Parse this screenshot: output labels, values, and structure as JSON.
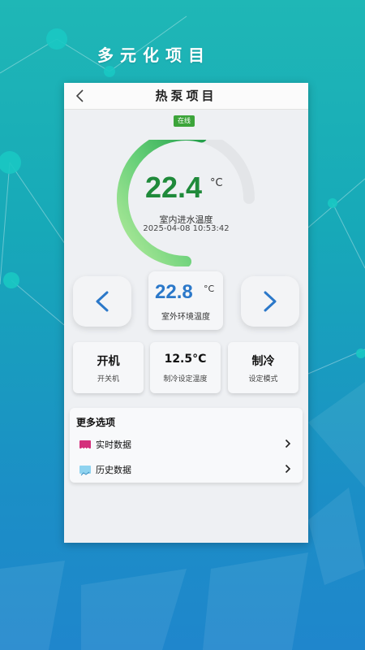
{
  "banner": {
    "title": "多元化项目"
  },
  "header": {
    "back_icon": "chevron-left-icon",
    "title": "热泵项目"
  },
  "status": {
    "badge": "在线",
    "color": "#3ca43a"
  },
  "indoor": {
    "value": "22.4",
    "unit": "°C",
    "label": "室内进水温度",
    "timestamp": "2025-04-08 10:53:42",
    "gauge_fraction": 0.72,
    "accent": "#1f8a3a"
  },
  "outdoor": {
    "value": "22.8",
    "unit": "°C",
    "label": "室外环境温度",
    "accent": "#2b78c9"
  },
  "nav": {
    "prev_icon": "chevron-left-icon",
    "next_icon": "chevron-right-icon"
  },
  "controls": [
    {
      "value": "开机",
      "label": "开关机"
    },
    {
      "value": "12.5°C",
      "label": "制冷设定温度"
    },
    {
      "value": "制冷",
      "label": "设定模式"
    }
  ],
  "more": {
    "title": "更多选项",
    "items": [
      {
        "label": "实时数据",
        "icon": "realtime-data-icon"
      },
      {
        "label": "历史数据",
        "icon": "history-data-icon"
      }
    ]
  }
}
